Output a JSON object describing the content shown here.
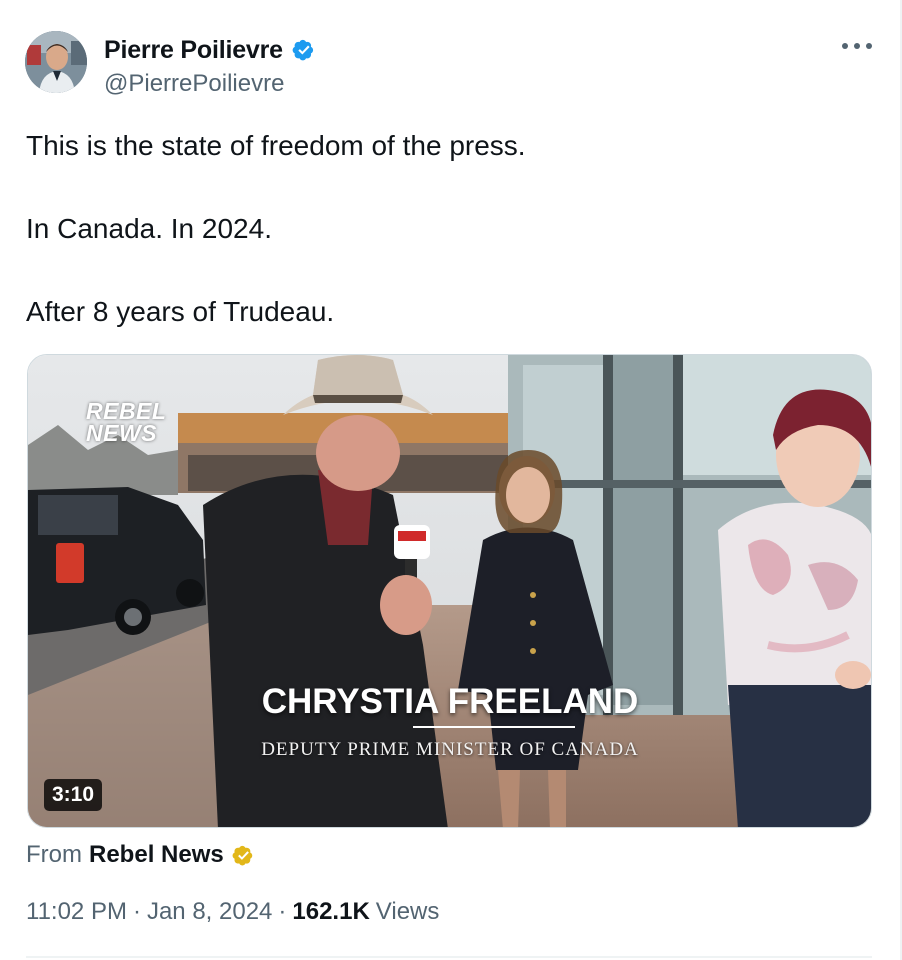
{
  "author": {
    "display_name": "Pierre Poilievre",
    "handle": "@PierrePoilievre",
    "verified_icon": "verified-badge-icon",
    "avatar_icon": "avatar-image"
  },
  "tweet": {
    "lines": [
      "This is the state of freedom of the press.",
      "In Canada. In 2024.",
      "After 8 years of Trudeau."
    ]
  },
  "media": {
    "logo_text_1": "REBEL",
    "logo_text_2": "NEWS",
    "caption_name": "CHRYSTIA FREELAND",
    "caption_title": "DEPUTY PRIME MINISTER OF CANADA",
    "duration": "3:10"
  },
  "attribution": {
    "prefix": "From",
    "source": "Rebel News",
    "badge_color": "#e2b719"
  },
  "meta": {
    "time": "11:02 PM",
    "separator": "·",
    "date": "Jan 8, 2024",
    "views_count": "162.1K",
    "views_label": "Views"
  },
  "colors": {
    "verified_blue": "#1d9bf0",
    "text_primary": "#0f1419",
    "text_secondary": "#536471"
  }
}
